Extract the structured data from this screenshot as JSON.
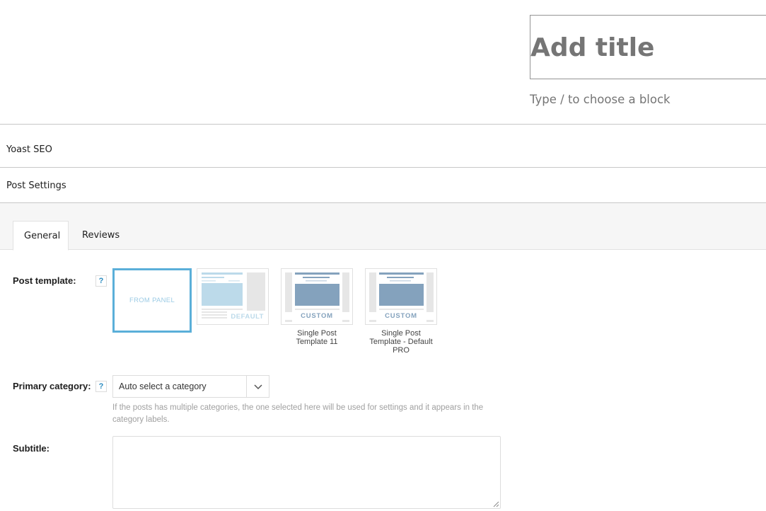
{
  "editor": {
    "title_placeholder": "Add title",
    "block_hint": "Type / to choose a block"
  },
  "metaboxes": {
    "yoast_label": "Yoast SEO",
    "post_settings_label": "Post Settings"
  },
  "tabs": [
    {
      "label": "General",
      "active": true
    },
    {
      "label": "Reviews",
      "active": false
    }
  ],
  "post_template": {
    "label": "Post template:",
    "help": "?",
    "options": [
      {
        "badge": "FROM PANEL",
        "caption": "",
        "selected": true
      },
      {
        "badge": "DEFAULT",
        "caption": "",
        "selected": false
      },
      {
        "badge": "CUSTOM",
        "caption": "Single Post Template 11",
        "selected": false
      },
      {
        "badge": "CUSTOM",
        "caption": "Single Post Template - Default PRO",
        "selected": false
      }
    ]
  },
  "primary_category": {
    "label": "Primary category:",
    "help": "?",
    "selected": "Auto select a category",
    "description": "If the posts has multiple categories, the one selected here will be used for settings and it appears in the category labels."
  },
  "subtitle": {
    "label": "Subtitle:",
    "value": ""
  },
  "colors": {
    "accent": "#5aafd9",
    "template_fill": "#84a2bd",
    "template_light": "#bcdaea"
  }
}
